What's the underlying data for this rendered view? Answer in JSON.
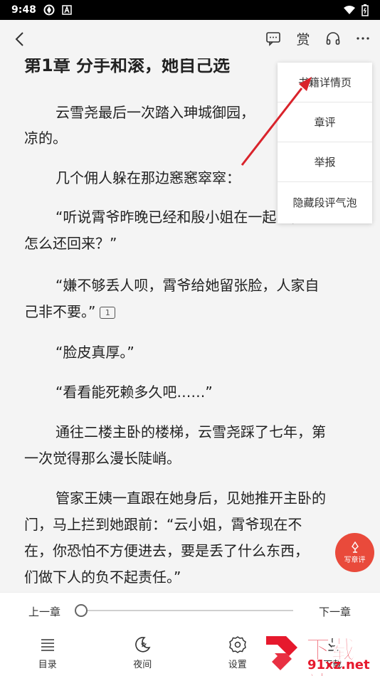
{
  "status_bar": {
    "time": "9:48"
  },
  "reader": {
    "chapter_title": "第1章 分手和滚，她自己选",
    "paragraphs": [
      "云雪尧最后一次踏入珅城御园，",
      "凉的。",
      "几个佣人躲在那边窸窸窣窣：",
      "“听说霄爷昨晚已经和殷小姐在一起了，",
      "怎么还回来？”",
      "“嫌不够丢人呗，霄爷给她留张脸，人家自",
      "己非不要。”",
      "“脸皮真厚。”",
      "“看看能死赖多久吧……”",
      "通往二楼主卧的楼梯，云雪尧踩了七年，第",
      "一次觉得那么漫长陡峭。",
      "管家王姨一直跟在她身后，见她推开主卧的",
      "门，马上拦到她跟前：“云小姐，霄爷现在不",
      "在，你恐怕不方便进去，要是丢了什么东西，",
      "们做下人的负不起责任。”"
    ],
    "comment_count": "1"
  },
  "menu": {
    "items": [
      "书籍详情页",
      "章评",
      "举报",
      "隐藏段评气泡"
    ]
  },
  "write_comment_label": "写章评",
  "progress": {
    "prev_label": "上一章",
    "next_label": "下一章",
    "value_percent": 0
  },
  "bottom_nav": {
    "items": [
      {
        "label": "目录",
        "icon": "list-icon"
      },
      {
        "label": "夜间",
        "icon": "moon-icon"
      },
      {
        "label": "设置",
        "icon": "gear-icon"
      },
      {
        "label": "下载",
        "icon": "download-icon"
      }
    ]
  },
  "watermark": {
    "text": "下载站",
    "url": "91xz.net"
  },
  "colors": {
    "accent": "#e94a3b",
    "watermark": "#e6192d",
    "arrow": "#d9232b"
  }
}
